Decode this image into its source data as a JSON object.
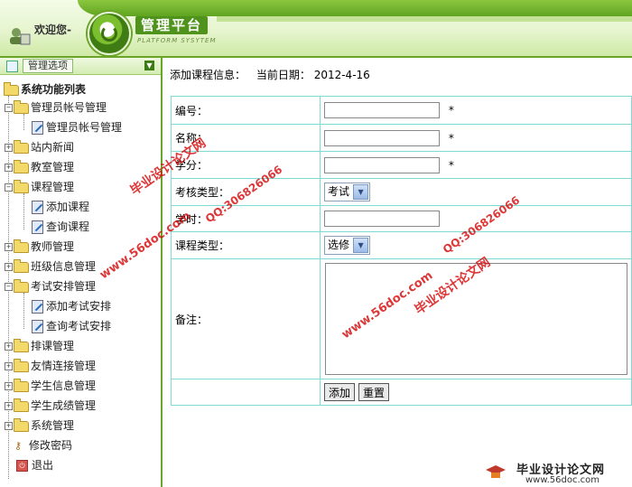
{
  "header": {
    "welcome": "欢迎您-",
    "title": "管理平台",
    "subtitle": "PLATFORM SYSYTEM"
  },
  "sidebar": {
    "tab_label": "管理选项",
    "root": "系统功能列表",
    "items": [
      {
        "label": "管理员帐号管理"
      },
      {
        "label": "管理员帐号管理"
      },
      {
        "label": "站内新闻"
      },
      {
        "label": "教室管理"
      },
      {
        "label": "课程管理"
      },
      {
        "label": "添加课程"
      },
      {
        "label": "查询课程"
      },
      {
        "label": "教师管理"
      },
      {
        "label": "班级信息管理"
      },
      {
        "label": "考试安排管理"
      },
      {
        "label": "添加考试安排"
      },
      {
        "label": "查询考试安排"
      },
      {
        "label": "排课管理"
      },
      {
        "label": "友情连接管理"
      },
      {
        "label": "学生信息管理"
      },
      {
        "label": "学生成绩管理"
      },
      {
        "label": "系统管理"
      },
      {
        "label": "修改密码"
      },
      {
        "label": "退出"
      }
    ]
  },
  "main": {
    "heading": "添加课程信息：",
    "date_label": "当前日期：",
    "date_value": "2012-4-16",
    "form": {
      "code_label": "编号：",
      "name_label": "名称：",
      "credit_label": "学分：",
      "exam_type_label": "考核类型：",
      "exam_type_value": "考试",
      "hours_label": "学时：",
      "course_type_label": "课程类型：",
      "course_type_value": "选修",
      "remark_label": "备注：",
      "required_mark": "*",
      "add_button": "添加",
      "reset_button": "重置"
    }
  },
  "watermarks": {
    "site_text": "毕业设计论文网",
    "url": "www.56doc.com",
    "qq": "QQ:306826066",
    "footer_url": "www.56doc.com"
  }
}
